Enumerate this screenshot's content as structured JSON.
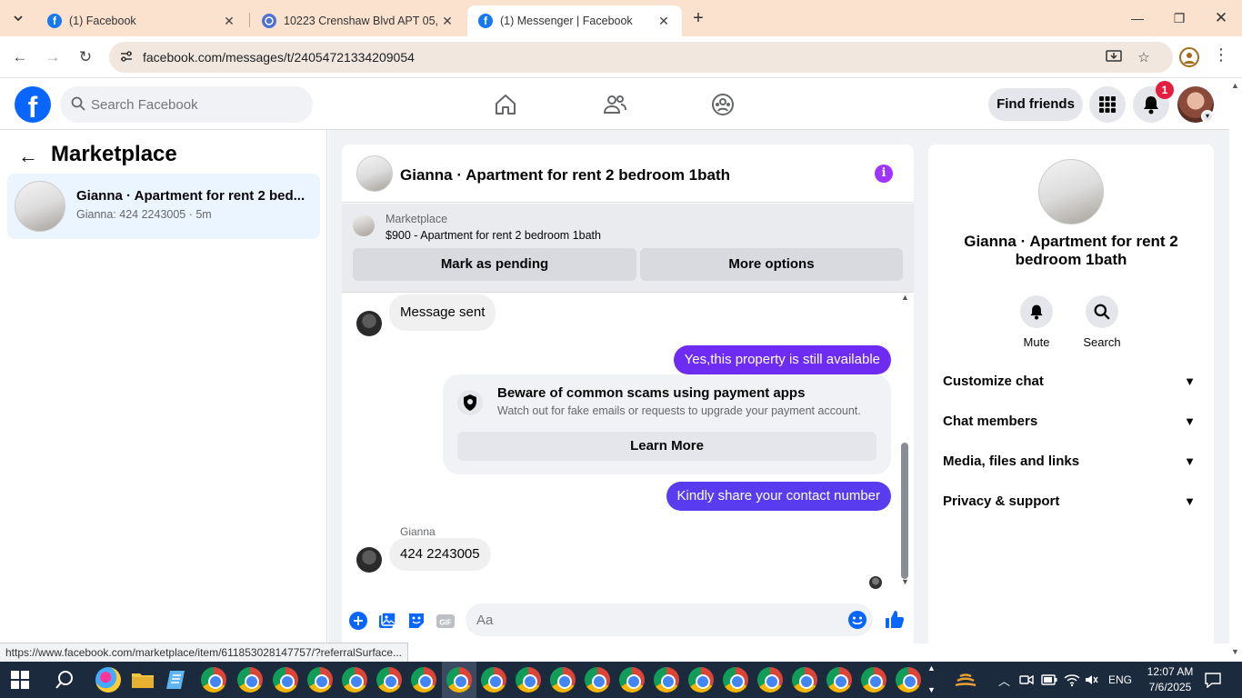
{
  "browser": {
    "tabs": [
      {
        "title": "(1) Facebook",
        "favicon": "facebook-icon"
      },
      {
        "title": "10223 Crenshaw Blvd APT 05, In",
        "favicon": "redfin-icon"
      },
      {
        "title": "(1) Messenger | Facebook",
        "favicon": "facebook-icon"
      }
    ],
    "url": "facebook.com/messages/t/24054721334209054",
    "status_url": "https://www.facebook.com/marketplace/item/611853028147757/?referralSurface..."
  },
  "fb": {
    "search_placeholder": "Search Facebook",
    "find_friends": "Find friends",
    "notification_count": "1"
  },
  "left": {
    "title": "Marketplace",
    "conversation": {
      "name": "Gianna · Apartment for rent 2 bed...",
      "preview": "Gianna: 424 2243005 · 5m"
    }
  },
  "chat": {
    "title": "Gianna · Apartment for rent 2 bedroom 1bath",
    "marketplace_label": "Marketplace",
    "listing": "$900 - Apartment for rent 2 bedroom 1bath",
    "mark_pending": "Mark as pending",
    "more_options": "More options",
    "messages": {
      "sent_notice": "Message sent",
      "out1": "Yes,this property is still available",
      "scam_title": "Beware of common scams using payment apps",
      "scam_sub": "Watch out for fake emails or requests to upgrade your payment account.",
      "learn_more": "Learn More",
      "out2": "Kindly share your contact number",
      "sender": "Gianna",
      "in_reply": "424 2243005"
    },
    "composer_placeholder": "Aa"
  },
  "right": {
    "name": "Gianna · Apartment for rent 2 bedroom 1bath",
    "mute": "Mute",
    "search": "Search",
    "rows": [
      "Customize chat",
      "Chat members",
      "Media, files and links",
      "Privacy & support"
    ]
  },
  "taskbar": {
    "lang": "ENG",
    "time": "12:07 AM",
    "date": "7/6/2025"
  },
  "colors": {
    "fb_blue": "#0866ff",
    "outgoing_bubble": "#6e2bf2",
    "notif_red": "#e41e3f",
    "tab_strip": "#fbe2cf"
  }
}
